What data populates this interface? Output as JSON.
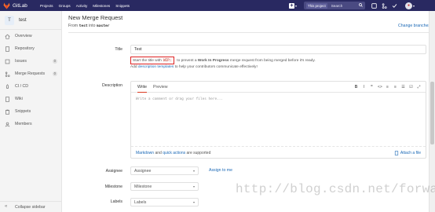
{
  "navbar": {
    "brand": "GitLab",
    "menu": [
      "Projects",
      "Groups",
      "Activity",
      "Milestones",
      "Snippets"
    ],
    "search_scope": "This project",
    "search_placeholder": "Search"
  },
  "sidebar": {
    "project_initial": "T",
    "project_name": "test",
    "items": [
      {
        "label": "Overview",
        "icon": "home-icon"
      },
      {
        "label": "Repository",
        "icon": "book-icon"
      },
      {
        "label": "Issues",
        "icon": "issues-icon",
        "count": "0"
      },
      {
        "label": "Merge Requests",
        "icon": "merge-request-icon",
        "count": "0"
      },
      {
        "label": "CI / CD",
        "icon": "rocket-icon"
      },
      {
        "label": "Wiki",
        "icon": "book-icon"
      },
      {
        "label": "Snippets",
        "icon": "clipboard-icon"
      },
      {
        "label": "Members",
        "icon": "users-icon"
      }
    ],
    "collapse_label": "Collapse sidebar"
  },
  "page": {
    "title": "New Merge Request",
    "from_prefix": "From",
    "source_branch": "test",
    "into_word": "into",
    "target_branch": "master",
    "change_branches": "Change branches"
  },
  "form": {
    "title_label": "Title",
    "title_value": "Test",
    "wip_pre": "Start the title with",
    "wip_code": "WIP:",
    "wip_mid": "to prevent a",
    "wip_strong": "Work In Progress",
    "wip_post": "merge request from being merged before it's ready.",
    "templates_pre": "Add",
    "templates_link": "description templates",
    "templates_post": "to help your contributors communicate effectively!",
    "description_label": "Description",
    "tab_write": "Write",
    "tab_preview": "Preview",
    "desc_placeholder": "Write a comment or drag your files here...",
    "markdown_link": "Markdown",
    "and_word": "and",
    "quick_actions_link": "quick actions",
    "supported_text": "are supported",
    "attach_label": "Attach a file",
    "assignee_label": "Assignee",
    "assignee_value": "Assignee",
    "assign_to_me": "Assign to me",
    "milestone_label": "Milestone",
    "milestone_value": "Milestone",
    "labels_label": "Labels",
    "labels_value": "Labels"
  },
  "toolbar": [
    "B",
    "I",
    "❞",
    "<>",
    "≡",
    "≡",
    "☰",
    "☑",
    "⤢"
  ],
  "watermark": "http://blog.csdn.net/forwardlee",
  "colors": {
    "navbar": "#292961",
    "link": "#1b69b6",
    "highlight_box": "#dd2222"
  }
}
